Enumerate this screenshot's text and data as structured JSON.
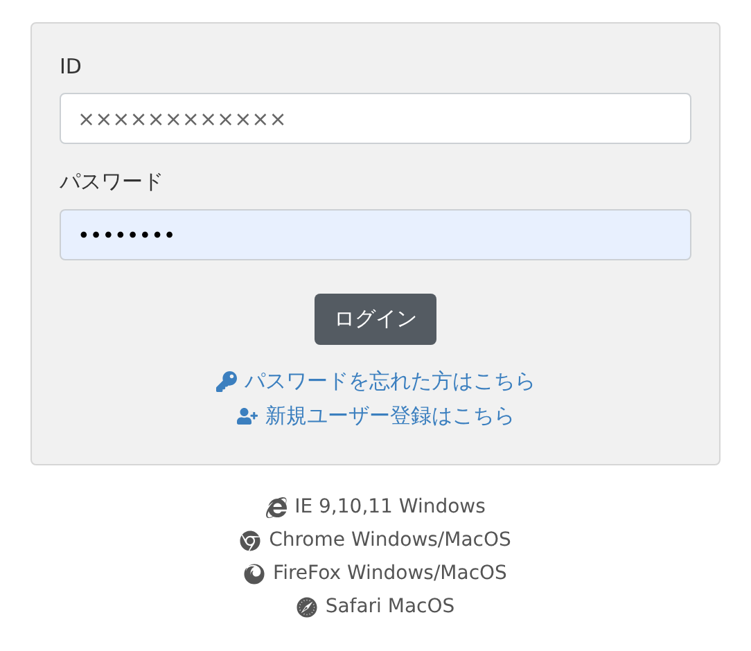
{
  "login_form": {
    "id_label": "ID",
    "id_value": "××××××××××××",
    "password_label": "パスワード",
    "password_value": "••••••••",
    "password_autofilled": true,
    "submit_button": "ログイン",
    "links": [
      {
        "kind": "key",
        "label": "パスワードを忘れた方はこちら"
      },
      {
        "kind": "user-plus",
        "label": "新規ユーザー登録はこちら"
      }
    ]
  },
  "supported_browsers": [
    {
      "kind": "ie",
      "label": "IE 9,10,11 Windows"
    },
    {
      "kind": "chrome",
      "label": "Chrome Windows/MacOS"
    },
    {
      "kind": "firefox",
      "label": "FireFox Windows/MacOS"
    },
    {
      "kind": "safari",
      "label": "Safari MacOS"
    }
  ]
}
